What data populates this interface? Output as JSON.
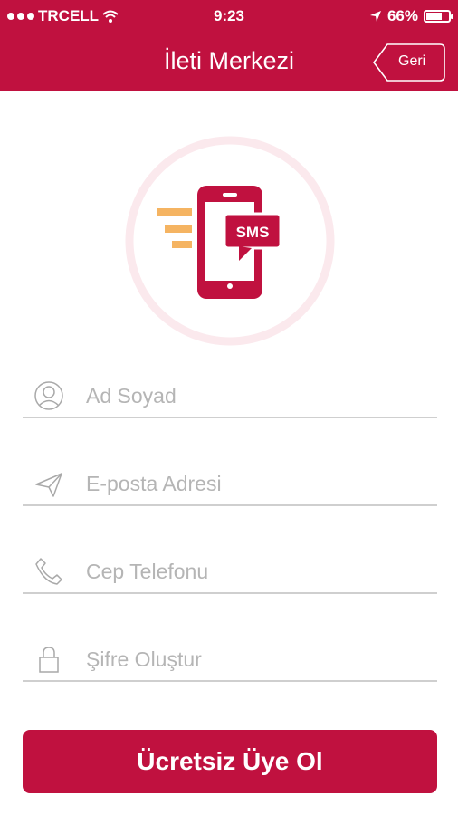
{
  "status_bar": {
    "carrier": "TRCELL",
    "time": "9:23",
    "battery": "66%",
    "battery_level": 0.66
  },
  "header": {
    "title": "İleti Merkezi",
    "back_label": "Geri"
  },
  "logo": {
    "badge_text": "SMS"
  },
  "form": {
    "name_placeholder": "Ad Soyad",
    "email_placeholder": "E-posta Adresi",
    "phone_placeholder": "Cep Telefonu",
    "password_placeholder": "Şifre Oluştur"
  },
  "submit_label": "Ücretsiz Üye Ol",
  "colors": {
    "brand": "#c0113f",
    "accent": "#f5b462"
  }
}
